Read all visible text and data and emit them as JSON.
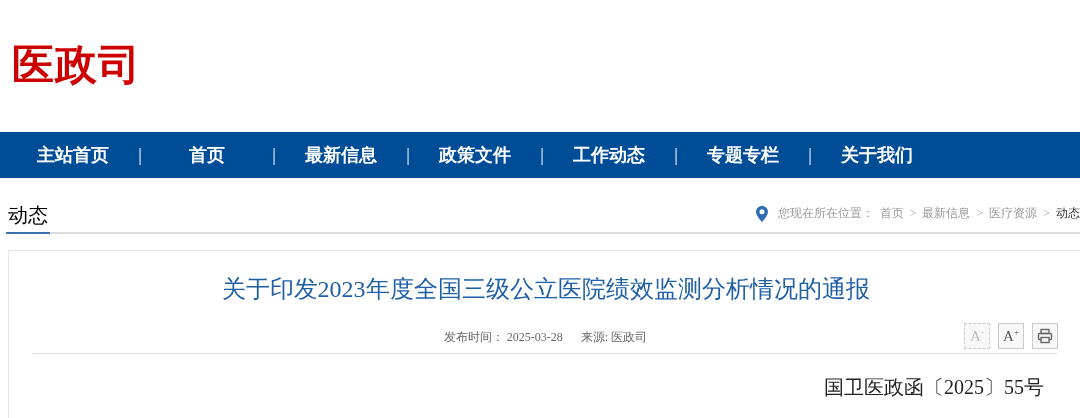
{
  "logo": "医政司",
  "nav": [
    {
      "label": "主站首页"
    },
    {
      "label": "首页"
    },
    {
      "label": "最新信息"
    },
    {
      "label": "政策文件"
    },
    {
      "label": "工作动态"
    },
    {
      "label": "专题专栏"
    },
    {
      "label": "关于我们"
    }
  ],
  "nav_separator": "|",
  "section_title": "动态",
  "breadcrumb": {
    "prefix": "您现在所在位置：",
    "items": [
      "首页",
      "最新信息",
      "医疗资源",
      "动态"
    ],
    "separator": ">"
  },
  "article": {
    "title": "关于印发2023年度全国三级公立医院绩效监测分析情况的通报",
    "meta": [
      {
        "label": "发布时间：",
        "value": "2025-03-28"
      },
      {
        "label": "来源:",
        "value": "医政司"
      }
    ],
    "tools": [
      {
        "kind": "font-smaller",
        "label": "A$^{-}$",
        "disabled": true
      },
      {
        "kind": "font-larger",
        "label": "A$^{+}$",
        "disabled": false
      },
      {
        "kind": "print"
      }
    ],
    "doc_number": "国卫医政函〔2025〕55号"
  }
}
